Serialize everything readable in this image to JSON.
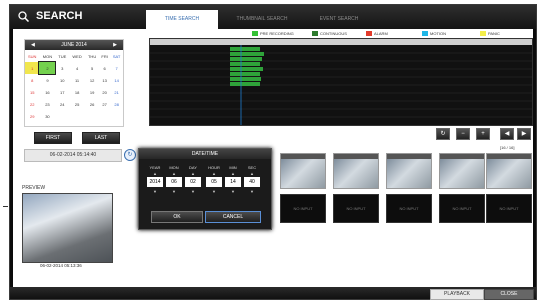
{
  "window": {
    "title": "SEARCH"
  },
  "tabs": [
    {
      "label": "TIME SEARCH"
    },
    {
      "label": "THUMBNAIL SEARCH"
    },
    {
      "label": "EVENT SEARCH"
    }
  ],
  "calendar": {
    "month_label": "JUNE 2014",
    "days": [
      "SUN",
      "MON",
      "TUE",
      "WED",
      "THU",
      "FRI",
      "SAT"
    ],
    "rows": [
      [
        "1",
        "2",
        "3",
        "4",
        "5",
        "6",
        "7"
      ],
      [
        "8",
        "9",
        "10",
        "11",
        "12",
        "13",
        "14"
      ],
      [
        "15",
        "16",
        "17",
        "18",
        "19",
        "20",
        "21"
      ],
      [
        "22",
        "23",
        "24",
        "25",
        "26",
        "27",
        "28"
      ],
      [
        "29",
        "30",
        "",
        "",
        "",
        "",
        ""
      ]
    ],
    "selected": "2"
  },
  "nav_buttons": {
    "first": "FIRST",
    "last": "LAST"
  },
  "datetime_field": "06-02-2014 05:14:40",
  "legend": [
    {
      "label": "PRE RECORDING",
      "color": "#34c134"
    },
    {
      "label": "CONTINUOUS",
      "color": "#2d7a2d"
    },
    {
      "label": "ALARM",
      "color": "#e23a2a"
    },
    {
      "label": "MOTION",
      "color": "#1fb6e6"
    },
    {
      "label": "PANIC",
      "color": "#f4ee4a"
    }
  ],
  "thumbs_page": "[16 / 16]",
  "thumbnails_nodata_label": "NO INPUT",
  "preview": {
    "label": "PREVIEW",
    "timestamp": "06-02-2014 05:13:36"
  },
  "dialog": {
    "title": "DATE/TIME",
    "fields": [
      {
        "label": "YEAR",
        "value": "2014"
      },
      {
        "label": "MON",
        "value": "06"
      },
      {
        "label": "DAY",
        "value": "02"
      },
      {
        "label": "HOUR",
        "value": "05"
      },
      {
        "label": "MIN",
        "value": "14"
      },
      {
        "label": "SEC",
        "value": "40"
      }
    ],
    "ok": "OK",
    "cancel": "CANCEL"
  },
  "bottom": {
    "playback": "PLAYBACK",
    "close": "CLOSE"
  }
}
